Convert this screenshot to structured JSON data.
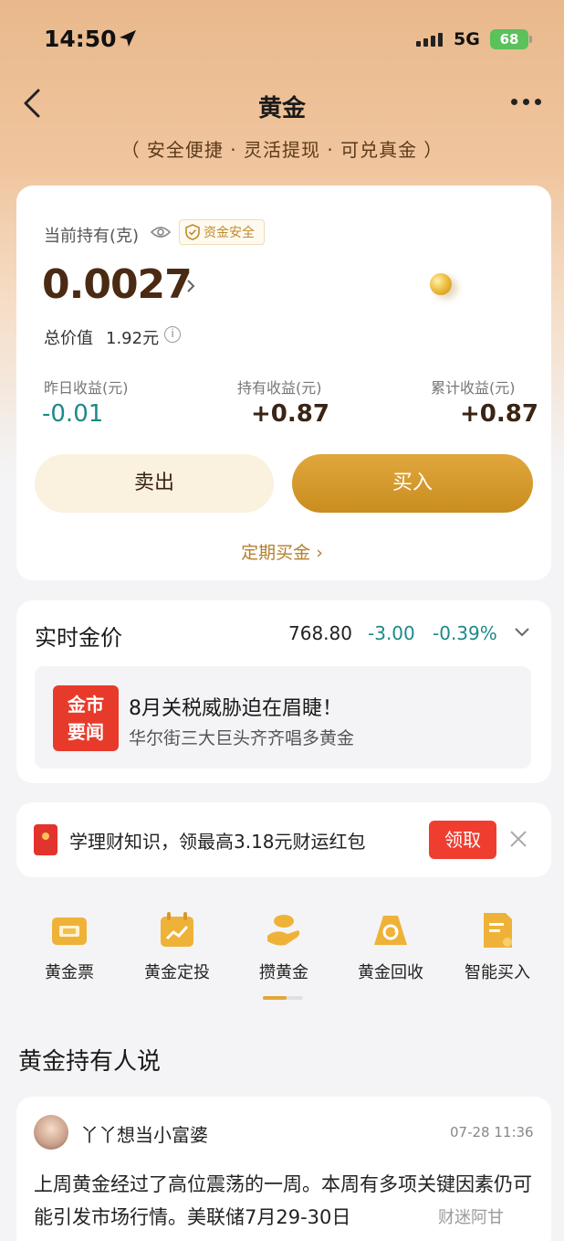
{
  "status_bar": {
    "time": "14:50",
    "network": "5G",
    "battery": "68"
  },
  "nav": {
    "title": "黄金",
    "tagline": "（ 安全便捷 · 灵活提现 · 可兑真金 ）"
  },
  "holdings": {
    "label": "当前持有(克)",
    "safe_badge": "资金安全",
    "amount": "0.0027",
    "total_label": "总价值",
    "total_value": "1.92元",
    "stats": [
      {
        "label": "昨日收益(元)",
        "value": "-0.01"
      },
      {
        "label": "持有收益(元)",
        "value": "+0.87"
      },
      {
        "label": "累计收益(元)",
        "value": "+0.87"
      }
    ],
    "sell_label": "卖出",
    "buy_label": "买入",
    "regular_buy": "定期买金 ›"
  },
  "price": {
    "title": "实时金价",
    "value": "768.80",
    "change": "-3.00",
    "percent": "-0.39%",
    "news_logo_line1": "金市",
    "news_logo_line2": "要闻",
    "news_headline": "8月关税威胁迫在眉睫！",
    "news_sub": "华尔街三大巨头齐齐唱多黄金"
  },
  "promo": {
    "text": "学理财知识，领最高3.18元财运红包",
    "claim_label": "领取"
  },
  "shortcuts": [
    {
      "label": "黄金票",
      "icon": "gold-ticket-icon"
    },
    {
      "label": "黄金定投",
      "icon": "calendar-chart-icon"
    },
    {
      "label": "攒黄金",
      "icon": "hand-gold-icon"
    },
    {
      "label": "黄金回收",
      "icon": "recycle-icon"
    },
    {
      "label": "智能买入",
      "icon": "smart-doc-icon"
    }
  ],
  "colors": {
    "accent_gold": "#c98d1f",
    "negative_teal": "#1d8a86",
    "promo_red": "#ef3d30"
  },
  "community": {
    "section_title": "黄金持有人说",
    "post": {
      "author": "丫丫想当小富婆",
      "time": "07-28 11:36",
      "body": "上周黄金经过了高位震荡的一周。本周有多项关键因素仍可能引发市场行情。美联储7月29-30日"
    },
    "watermark": "财迷阿甘"
  }
}
